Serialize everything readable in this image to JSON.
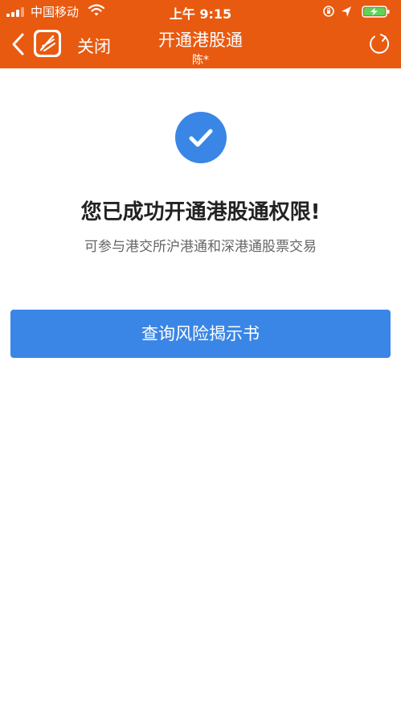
{
  "status_bar": {
    "carrier": "中国移动",
    "time": "上午 9:15"
  },
  "nav": {
    "close_label": "关闭",
    "title": "开通港股通",
    "subtitle": "陈*"
  },
  "main": {
    "title": "您已成功开通港股通权限!",
    "description": "可参与港交所沪港通和深港通股票交易",
    "button_label": "查询风险揭示书"
  },
  "colors": {
    "header_bg": "#e85a10",
    "accent_blue": "#3a86e6",
    "battery_green": "#5fd35a"
  },
  "icons": {
    "signal": "signal-bars-icon",
    "wifi": "wifi-icon",
    "back": "chevron-left-icon",
    "logo": "app-logo-icon",
    "refresh": "refresh-icon",
    "success": "checkmark-circle-icon",
    "battery": "battery-charging-icon",
    "location": "location-arrow-icon",
    "lock": "orientation-lock-icon"
  }
}
